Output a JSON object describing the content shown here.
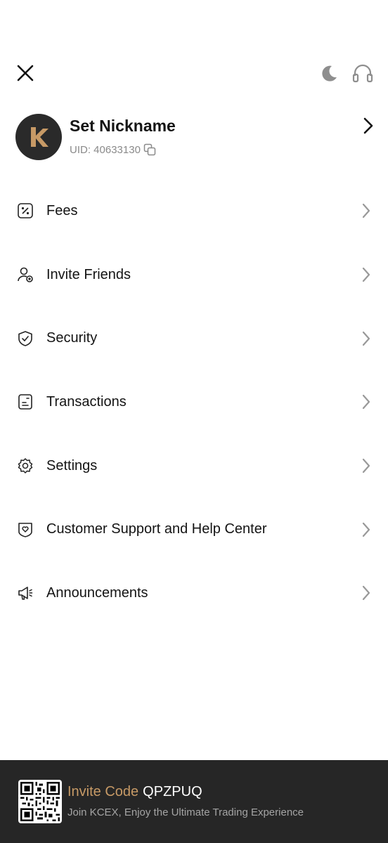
{
  "header": {
    "close_icon": "close-icon",
    "theme_icon": "moon-icon",
    "support_icon": "headset-icon"
  },
  "profile": {
    "nickname": "Set Nickname",
    "uid_label": "UID: 40633130",
    "avatar_letter": "K",
    "avatar_color": "#2a2a2a",
    "avatar_accent": "#c79a66"
  },
  "menu": {
    "items": [
      {
        "label": "Fees",
        "icon": "percent-icon"
      },
      {
        "label": "Invite Friends",
        "icon": "user-plus-icon"
      },
      {
        "label": "Security",
        "icon": "shield-check-icon"
      },
      {
        "label": "Transactions",
        "icon": "document-icon"
      },
      {
        "label": "Settings",
        "icon": "gear-icon"
      },
      {
        "label": "Customer Support and Help Center",
        "icon": "heart-shield-icon"
      },
      {
        "label": "Announcements",
        "icon": "megaphone-icon"
      }
    ]
  },
  "footer": {
    "invite_label": "Invite Code",
    "invite_code": "QPZPUQ",
    "tagline": "Join KCEX, Enjoy the Ultimate Trading Experience",
    "background": "#262626",
    "accent": "#c79a66"
  }
}
